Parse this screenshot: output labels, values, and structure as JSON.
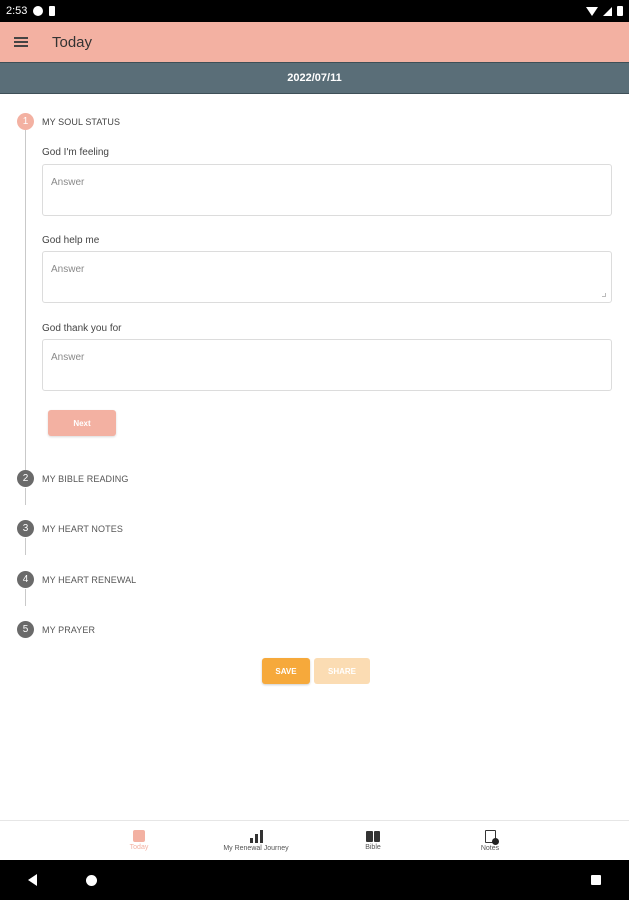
{
  "status_bar": {
    "time": "2:53"
  },
  "app_bar": {
    "title": "Today"
  },
  "date_bar": {
    "date": "2022/07/11"
  },
  "steps": [
    {
      "number": "1",
      "label": "MY SOUL STATUS"
    },
    {
      "number": "2",
      "label": "MY BIBLE READING"
    },
    {
      "number": "3",
      "label": "MY HEART NOTES"
    },
    {
      "number": "4",
      "label": "MY HEART RENEWAL"
    },
    {
      "number": "5",
      "label": "MY PRAYER"
    }
  ],
  "soul_status": {
    "fields": [
      {
        "label": "God I'm feeling",
        "placeholder": "Answer"
      },
      {
        "label": "God help me",
        "placeholder": "Answer"
      },
      {
        "label": "God thank you for",
        "placeholder": "Answer"
      }
    ],
    "next_label": "Next"
  },
  "actions": {
    "save_label": "SAVE",
    "share_label": "SHARE"
  },
  "bottom_nav": [
    {
      "label": "Today",
      "icon": "today-icon"
    },
    {
      "label": "My Renewal Journey",
      "icon": "bar-chart-icon"
    },
    {
      "label": "Bible",
      "icon": "book-icon"
    },
    {
      "label": "Notes",
      "icon": "notes-icon"
    }
  ],
  "colors": {
    "accent": "#f3b1a2",
    "date_bar": "#5a6e78",
    "save": "#f6a93b",
    "share": "#fbdcb3"
  }
}
